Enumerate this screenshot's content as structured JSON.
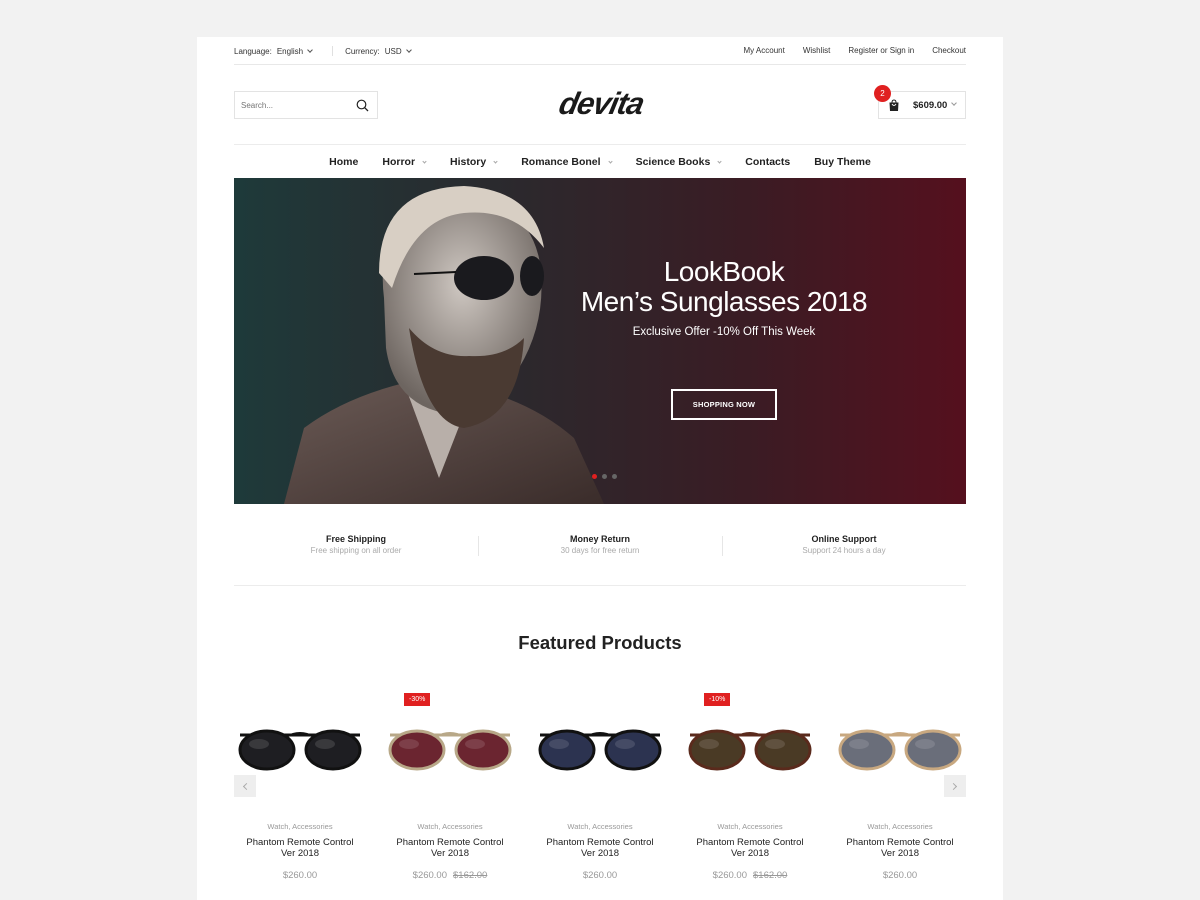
{
  "topbar": {
    "language_label": "Language:",
    "language_value": "English",
    "currency_label": "Currency:",
    "currency_value": "USD",
    "links": [
      "My Account",
      "Wishlist",
      "Register or Sign in",
      "Checkout"
    ]
  },
  "header": {
    "search_placeholder": "Search...",
    "logo_text": "devita",
    "cart_count": "2",
    "cart_total": "$609.00"
  },
  "nav": {
    "items": [
      {
        "label": "Home",
        "dropdown": false
      },
      {
        "label": "Horror",
        "dropdown": true
      },
      {
        "label": "History",
        "dropdown": true
      },
      {
        "label": "Romance Bonel",
        "dropdown": true
      },
      {
        "label": "Science Books",
        "dropdown": true
      },
      {
        "label": "Contacts",
        "dropdown": false
      },
      {
        "label": "Buy Theme",
        "dropdown": false
      }
    ]
  },
  "hero": {
    "title_line1": "LookBook",
    "title_line2": "Men’s Sunglasses 2018",
    "subtitle": "Exclusive Offer -10% Off This Week",
    "button": "SHOPPING NOW",
    "active_slide": 1,
    "slide_count": 3
  },
  "features": [
    {
      "title": "Free Shipping",
      "desc": "Free shipping on all order"
    },
    {
      "title": "Money Return",
      "desc": "30 days for free return"
    },
    {
      "title": "Online Support",
      "desc": "Support 24 hours a day"
    }
  ],
  "featured": {
    "title": "Featured Products",
    "products": [
      {
        "category": "Watch, Accessories",
        "name": "Phantom Remote Control Ver 2018",
        "price": "$260.00",
        "old_price": "",
        "sale": "",
        "lens": "#1e1e22",
        "frame": "#111111"
      },
      {
        "category": "Watch, Accessories",
        "name": "Phantom Remote Control Ver 2018",
        "price": "$260.00",
        "old_price": "$162.00",
        "sale": "-30%",
        "lens": "#6b2530",
        "frame": "#b8a888"
      },
      {
        "category": "Watch, Accessories",
        "name": "Phantom Remote Control Ver 2018",
        "price": "$260.00",
        "old_price": "",
        "sale": "",
        "lens": "#2c3350",
        "frame": "#111111"
      },
      {
        "category": "Watch, Accessories",
        "name": "Phantom Remote Control Ver 2018",
        "price": "$260.00",
        "old_price": "$162.00",
        "sale": "-10%",
        "lens": "#4a3a25",
        "frame": "#5a2a1c"
      },
      {
        "category": "Watch, Accessories",
        "name": "Phantom Remote Control Ver 2018",
        "price": "$260.00",
        "old_price": "",
        "sale": "",
        "lens": "#6a6e7a",
        "frame": "#c8a880"
      }
    ]
  },
  "colors": {
    "accent": "#e02020"
  }
}
